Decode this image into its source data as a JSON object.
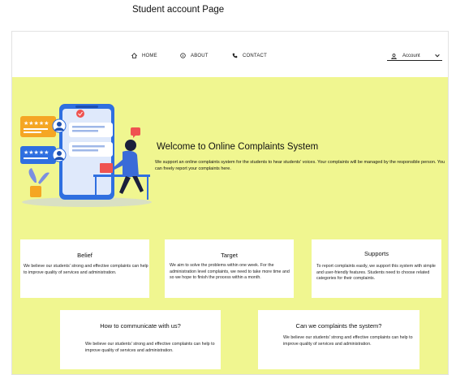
{
  "caption": "Student account Page",
  "nav": {
    "home": "HOME",
    "about": "ABOUT",
    "contact": "CONTACT",
    "account": "Account",
    "icons": [
      "home-icon",
      "info-icon",
      "phone-icon",
      "user-icon",
      "chevron-down-icon"
    ]
  },
  "hero": {
    "title": "Welcome to Online Complaints System",
    "text": "We support an online complaints system for the students to hear students' voices. Your complaints will be managed by the responsible person. You can freely report your complaints here."
  },
  "cards": {
    "belief": {
      "title": "Belief",
      "text": "We believe our students' strong and effective complaints can help to improve quality of services and administration."
    },
    "target": {
      "title": "Target",
      "text": "We aim to solve the problems within one week. For the administration level complaints, we need to take more time and so we hope to finish the process within a month."
    },
    "supports": {
      "title": "Supports",
      "text": "To report complaints easily, we support this system with simple and user-friendly features. Students need to choose related categories for their complaints."
    },
    "communicate": {
      "title": "How to communicate with  us?",
      "text": "We believe our students' strong and effective complaints can help to improve quality of services and administration."
    },
    "complaint": {
      "title": "Can we complaints the system?",
      "text": "We believe our students' strong and effective complaints can help to improve quality of services and administration."
    }
  },
  "colors": {
    "background": "#f0f690",
    "illustration_blue": "#2f6fe0",
    "illustration_orange": "#f5a623",
    "illustration_red": "#ef5350"
  }
}
